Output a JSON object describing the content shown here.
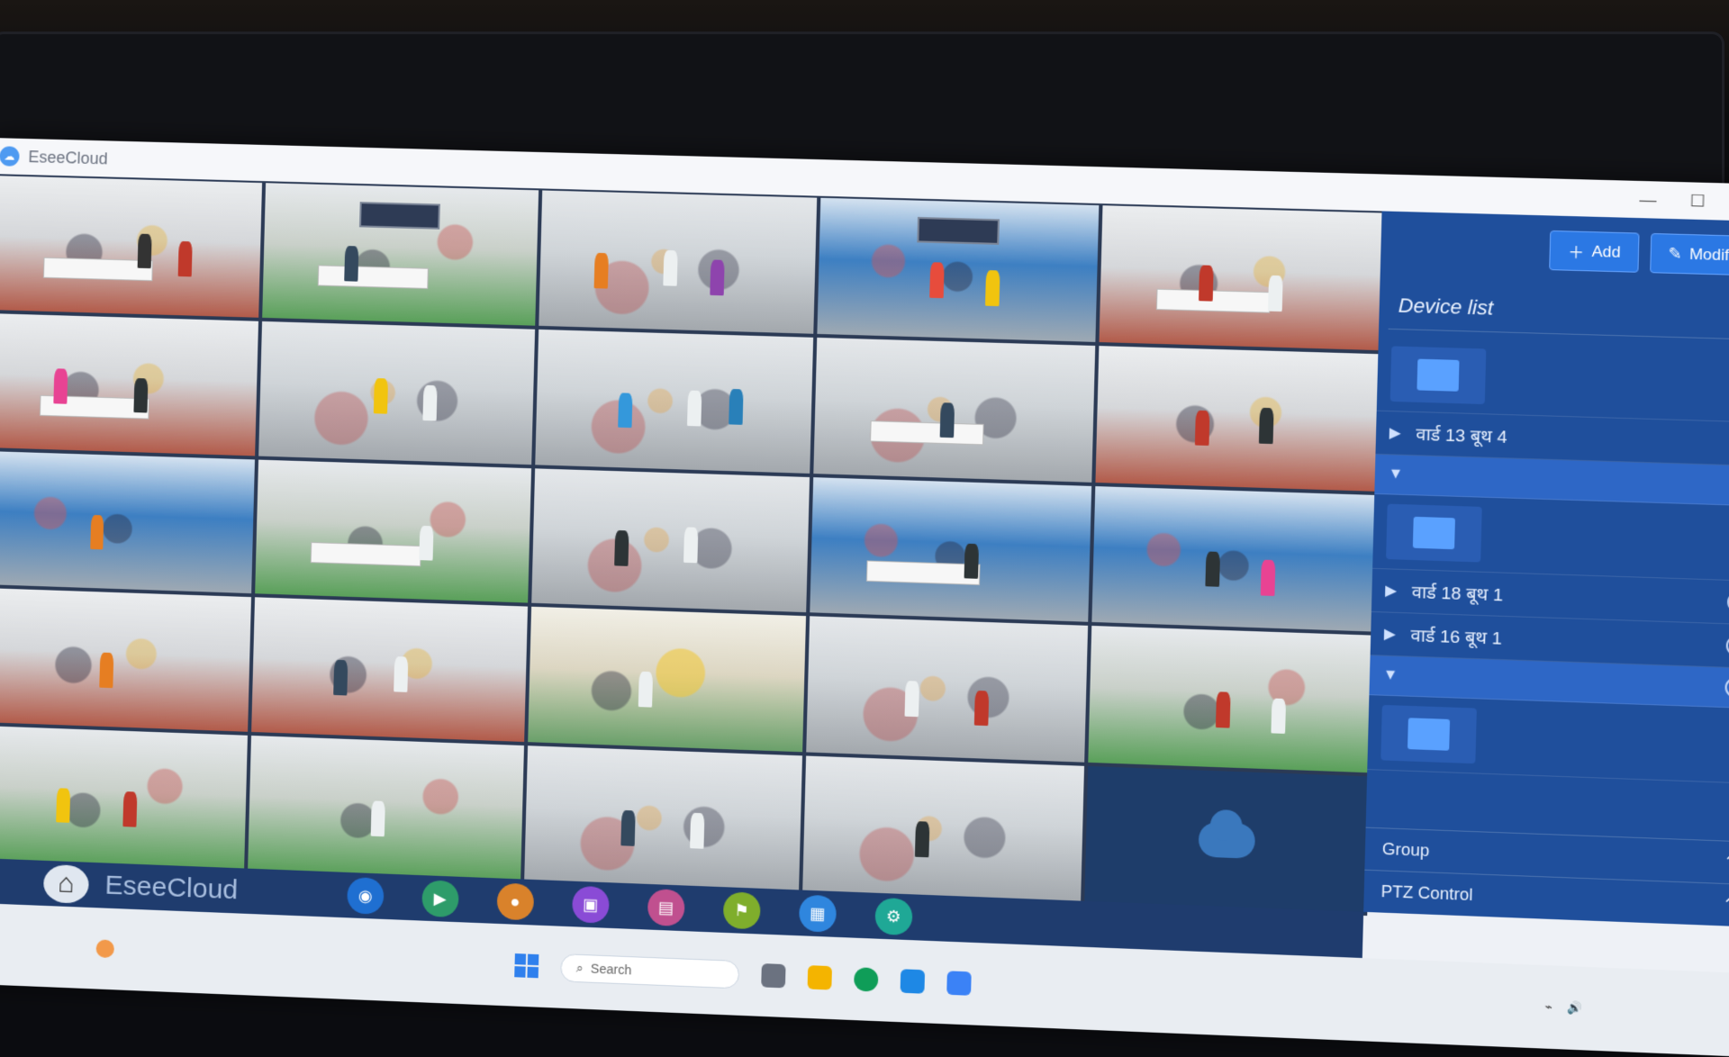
{
  "window": {
    "title": "EseeCloud",
    "controls": [
      "—",
      "☐",
      "✕"
    ]
  },
  "panel": {
    "add_label": "Add",
    "modify_label": "Modify",
    "device_list_label": "Device list",
    "items": [
      {
        "name": "वार्ड 13 बूथ 4"
      },
      {
        "name": "वार्ड 18 बूथ 1"
      },
      {
        "name": "वार्ड 16 बूथ 1"
      }
    ],
    "group_label": "Group",
    "ptz_label": "PTZ Control"
  },
  "appbar": {
    "brand": "EseeCloud"
  },
  "taskbar": {
    "search_placeholder": "Search"
  },
  "colors": {
    "panel": "#1f4f9c",
    "accent": "#2b78e4",
    "appbar": "#1f3c6e"
  }
}
